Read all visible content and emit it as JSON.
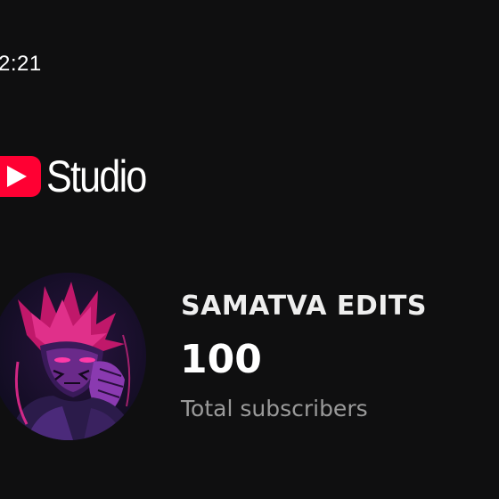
{
  "status_bar": {
    "time": "2:21"
  },
  "header": {
    "app_name": "Studio",
    "logo_icon": "youtube-play-icon",
    "brand_color": "#ff0033"
  },
  "channel": {
    "name": "SAMATVA EDITS",
    "subscriber_count": "100",
    "subscriber_label": "Total subscribers",
    "avatar_icon": "channel-avatar-image"
  }
}
